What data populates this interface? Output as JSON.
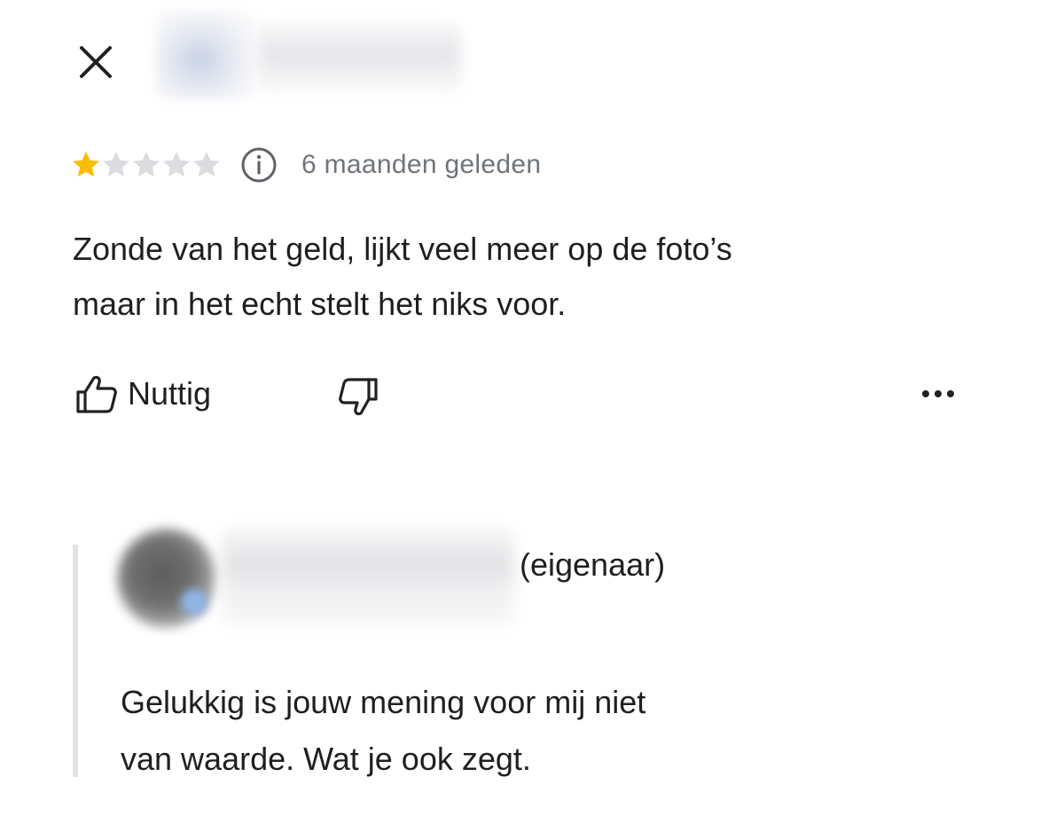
{
  "review": {
    "rating": 1,
    "max_rating": 5,
    "date": "6 maanden geleden",
    "text": "Zonde van het geld, lijkt veel meer op de foto’s\nmaar in het echt stelt het niks voor.",
    "star_color_filled": "#fbbc04",
    "star_color_empty": "#dadce0"
  },
  "actions": {
    "helpful_label": "Nuttig"
  },
  "icons": {
    "close": "close-icon",
    "info": "info-icon",
    "thumbs_up": "thumbs-up-icon",
    "thumbs_down": "thumbs-down-icon",
    "more": "more-horizontal-icon"
  },
  "owner_reply": {
    "owner_label": "(eigenaar)",
    "text": "Gelukkig is jouw mening voor mij niet\nvan waarde. Wat je ook zegt."
  }
}
